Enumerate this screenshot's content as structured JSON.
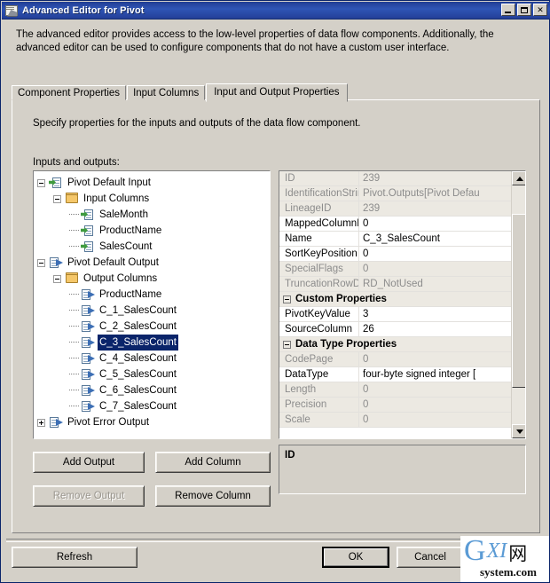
{
  "window": {
    "title": "Advanced Editor for Pivot",
    "icon": "advanced-editor-icon",
    "controls": {
      "minimize": "_",
      "maximize": "□",
      "close": "✕"
    }
  },
  "intro": "The advanced editor provides access to the low-level properties of data flow components. Additionally, the advanced editor can be used to configure components that do not have a custom user interface.",
  "tabs": [
    {
      "label": "Component Properties",
      "active": false
    },
    {
      "label": "Input Columns",
      "active": false
    },
    {
      "label": "Input and Output Properties",
      "active": true
    }
  ],
  "panel": {
    "specify_text": "Specify properties for the inputs and outputs of the data flow component.",
    "tree_label": "Inputs and outputs:"
  },
  "tree": [
    {
      "label": "Pivot Default Input",
      "depth": 0,
      "icon": "input-icon",
      "expander": "minus",
      "selected": false
    },
    {
      "label": "Input Columns",
      "depth": 1,
      "icon": "folder-icon",
      "expander": "minus",
      "selected": false
    },
    {
      "label": "SaleMonth",
      "depth": 2,
      "icon": "input-icon",
      "expander": "none",
      "selected": false
    },
    {
      "label": "ProductName",
      "depth": 2,
      "icon": "input-icon",
      "expander": "none",
      "selected": false
    },
    {
      "label": "SalesCount",
      "depth": 2,
      "icon": "input-icon",
      "expander": "none",
      "selected": false
    },
    {
      "label": "Pivot Default Output",
      "depth": 0,
      "icon": "output-icon",
      "expander": "minus",
      "selected": false
    },
    {
      "label": "Output Columns",
      "depth": 1,
      "icon": "folder-icon",
      "expander": "minus",
      "selected": false
    },
    {
      "label": "ProductName",
      "depth": 2,
      "icon": "output-icon",
      "expander": "none",
      "selected": false
    },
    {
      "label": "C_1_SalesCount",
      "depth": 2,
      "icon": "output-icon",
      "expander": "none",
      "selected": false
    },
    {
      "label": "C_2_SalesCount",
      "depth": 2,
      "icon": "output-icon",
      "expander": "none",
      "selected": false
    },
    {
      "label": "C_3_SalesCount",
      "depth": 2,
      "icon": "output-icon",
      "expander": "none",
      "selected": true
    },
    {
      "label": "C_4_SalesCount",
      "depth": 2,
      "icon": "output-icon",
      "expander": "none",
      "selected": false
    },
    {
      "label": "C_5_SalesCount",
      "depth": 2,
      "icon": "output-icon",
      "expander": "none",
      "selected": false
    },
    {
      "label": "C_6_SalesCount",
      "depth": 2,
      "icon": "output-icon",
      "expander": "none",
      "selected": false
    },
    {
      "label": "C_7_SalesCount",
      "depth": 2,
      "icon": "output-icon",
      "expander": "none",
      "selected": false
    },
    {
      "label": "Pivot Error Output",
      "depth": 0,
      "icon": "output-icon",
      "expander": "plus",
      "selected": false
    }
  ],
  "property_grid": {
    "rows": [
      {
        "kind": "property",
        "name": "ID",
        "value": "239",
        "readonly": true
      },
      {
        "kind": "property",
        "name": "IdentificationString",
        "value": "Pivot.Outputs[Pivot Defau",
        "readonly": true
      },
      {
        "kind": "property",
        "name": "LineageID",
        "value": "239",
        "readonly": true
      },
      {
        "kind": "property",
        "name": "MappedColumnID",
        "value": "0",
        "readonly": false
      },
      {
        "kind": "property",
        "name": "Name",
        "value": "C_3_SalesCount",
        "readonly": false
      },
      {
        "kind": "property",
        "name": "SortKeyPosition",
        "value": "0",
        "readonly": false
      },
      {
        "kind": "property",
        "name": "SpecialFlags",
        "value": "0",
        "readonly": true
      },
      {
        "kind": "property",
        "name": "TruncationRowDisposit",
        "value": "RD_NotUsed",
        "readonly": true
      },
      {
        "kind": "header",
        "name": "Custom Properties",
        "value": "",
        "readonly": false
      },
      {
        "kind": "property",
        "name": "PivotKeyValue",
        "value": "3",
        "readonly": false
      },
      {
        "kind": "property",
        "name": "SourceColumn",
        "value": "26",
        "readonly": false
      },
      {
        "kind": "header",
        "name": "Data Type Properties",
        "value": "",
        "readonly": false
      },
      {
        "kind": "property",
        "name": "CodePage",
        "value": "0",
        "readonly": true
      },
      {
        "kind": "property",
        "name": "DataType",
        "value": "four-byte signed integer [",
        "readonly": false
      },
      {
        "kind": "property",
        "name": "Length",
        "value": "0",
        "readonly": true
      },
      {
        "kind": "property",
        "name": "Precision",
        "value": "0",
        "readonly": true
      },
      {
        "kind": "property",
        "name": "Scale",
        "value": "0",
        "readonly": true
      }
    ],
    "scrollbar": {
      "up": "scroll-up-icon",
      "down": "scroll-down-icon"
    }
  },
  "description": {
    "title": "ID",
    "body": ""
  },
  "buttons": {
    "add_output": {
      "label": "Add Output",
      "disabled": false
    },
    "add_column": {
      "label": "Add Column",
      "disabled": false
    },
    "remove_output": {
      "label": "Remove Output",
      "disabled": true
    },
    "remove_column": {
      "label": "Remove Column",
      "disabled": false
    },
    "refresh": {
      "label": "Refresh",
      "disabled": false
    },
    "ok": {
      "label": "OK",
      "disabled": false
    },
    "cancel": {
      "label": "Cancel",
      "disabled": false
    }
  },
  "watermark": {
    "g": "G",
    "xi": "XI",
    "cn": "网",
    "domain": "system.com"
  },
  "colors": {
    "titlebar_start": "#1b3a90",
    "titlebar_end": "#12275f",
    "face": "#d4d0c8",
    "selection": "#0a246a",
    "readonly_text": "#8c8c8c",
    "watermark_blue": "#5b9bd5"
  }
}
